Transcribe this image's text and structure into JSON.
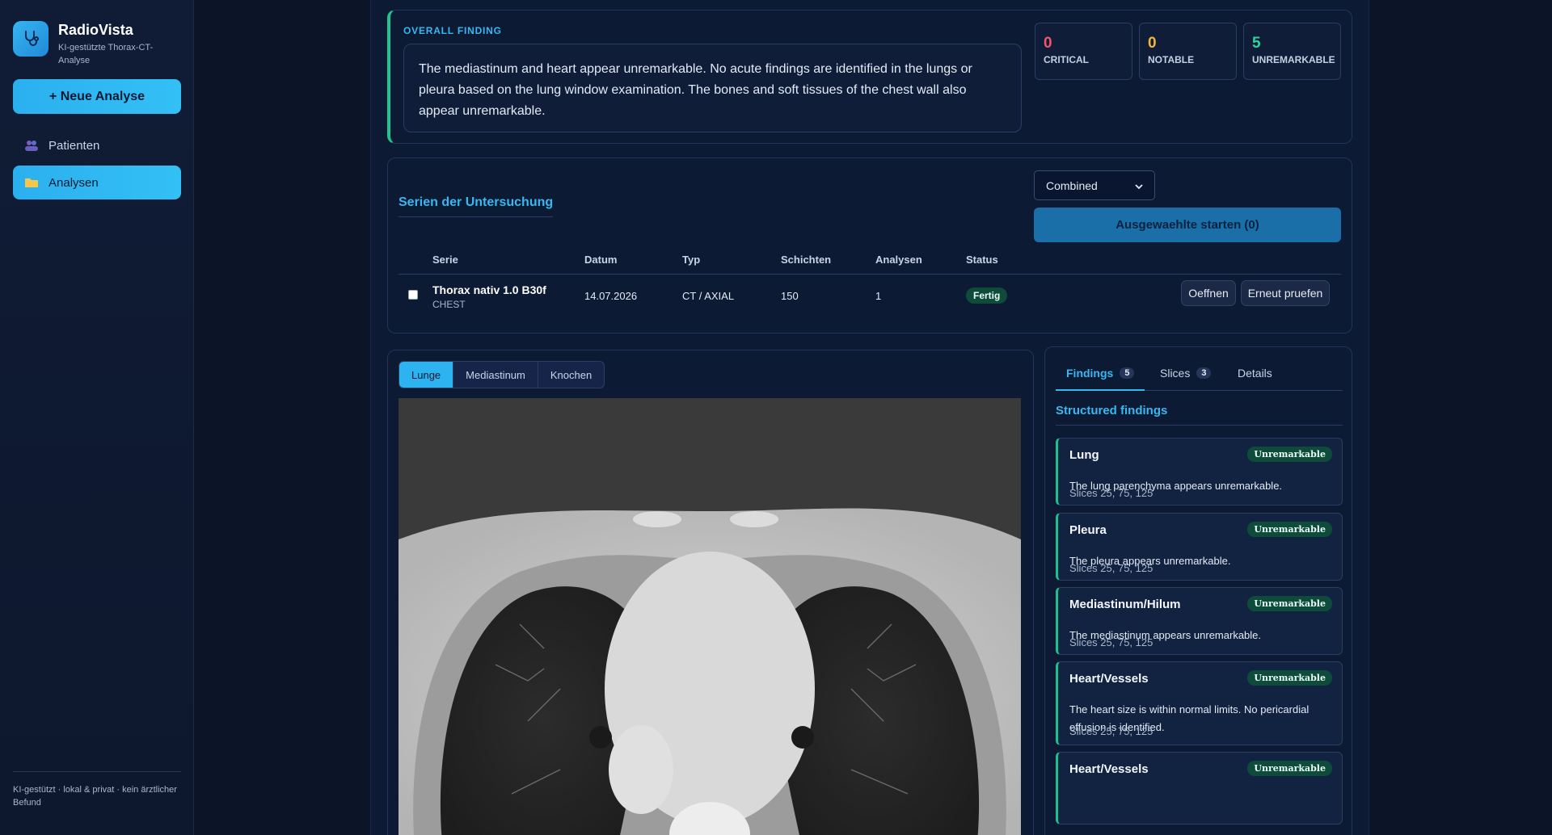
{
  "app": {
    "name": "RadioVista",
    "subtitle": "KI-gestützte Thorax-CT-Analyse",
    "new_analysis_label": "+ Neue Analyse",
    "footer": "KI-gestützt · lokal & privat · kein ärztlicher Befund"
  },
  "nav": {
    "items": [
      {
        "label": "Patienten",
        "icon": "people-icon",
        "active": false
      },
      {
        "label": "Analysen",
        "icon": "folder-icon",
        "active": true
      }
    ]
  },
  "overall": {
    "label": "OVERALL FINDING",
    "text": "The mediastinum and heart appear unremarkable. No acute findings are identified in the lungs or pleura based on the lung window examination. The bones and soft tissues of the chest wall also appear unremarkable.",
    "stats": [
      {
        "value": "0",
        "label": "CRITICAL",
        "color": "#f0556a"
      },
      {
        "value": "0",
        "label": "NOTABLE",
        "color": "#f5b43c"
      },
      {
        "value": "5",
        "label": "UNREMARKABLE",
        "color": "#2fd39c"
      }
    ]
  },
  "series": {
    "title": "Serien der Untersuchung",
    "mode_selected": "Combined",
    "start_label": "Ausgewaehlte starten (0)",
    "columns": [
      "Serie",
      "Datum",
      "Typ",
      "Schichten",
      "Analysen",
      "Status"
    ],
    "rows": [
      {
        "name": "Thorax nativ 1.0 B30f",
        "region": "CHEST",
        "date": "14.07.2026",
        "type": "CT / AXIAL",
        "slices": "150",
        "analyses": "1",
        "status": "Fertig",
        "open_label": "Oeffnen",
        "recheck_label": "Erneut pruefen"
      }
    ]
  },
  "viewer": {
    "windows": [
      "Lunge",
      "Mediastinum",
      "Knochen"
    ],
    "active_window": "Lunge"
  },
  "findings": {
    "tabs": [
      {
        "label": "Findings",
        "count": "5"
      },
      {
        "label": "Slices",
        "count": "3"
      },
      {
        "label": "Details",
        "count": ""
      }
    ],
    "section_title": "Structured findings",
    "items": [
      {
        "title": "Lung",
        "badge": "Unremarkable",
        "desc": "The lung parenchyma appears unremarkable.",
        "slices": "Slices 25, 75, 125"
      },
      {
        "title": "Pleura",
        "badge": "Unremarkable",
        "desc": "The pleura appears unremarkable.",
        "slices": "Slices 25, 75, 125"
      },
      {
        "title": "Mediastinum/Hilum",
        "badge": "Unremarkable",
        "desc": "The mediastinum appears unremarkable.",
        "slices": "Slices 25, 75, 125"
      },
      {
        "title": "Heart/Vessels",
        "badge": "Unremarkable",
        "desc": "The heart size is within normal limits. No pericardial effusion is identified.",
        "slices": "Slices 25, 75, 125"
      },
      {
        "title": "Heart/Vessels",
        "badge": "Unremarkable",
        "desc": "",
        "slices": ""
      }
    ]
  }
}
